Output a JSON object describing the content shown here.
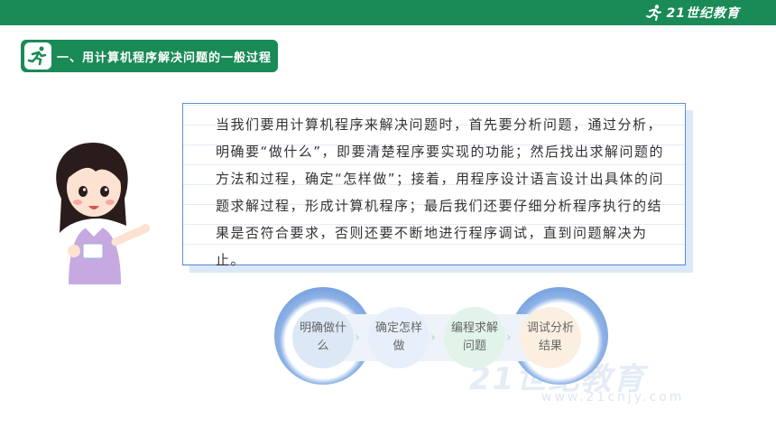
{
  "brand": {
    "name": "21世纪教育",
    "sub": "WWW.21CNJY.COM"
  },
  "section": {
    "title": "一、用计算机程序解决问题的一般过程",
    "icon": "runner-icon"
  },
  "card": {
    "text": "当我们要用计算机程序来解决问题时，首先要分析问题，通过分析，明确要“做什么”，即要清楚程序要实现的功能；然后找出求解问题的方法和过程，确定“怎样做”；接着，用程序设计语言设计出具体的问题求解过程，形成计算机程序；最后我们还要仔细分析程序执行的结果是否符合要求，否则还要不断地进行程序调试，直到问题解决为止。"
  },
  "flow": {
    "steps": [
      "明确做什么",
      "确定怎样做",
      "编程求解问题",
      "调试分析结果"
    ]
  },
  "watermark": {
    "main": "21世纪教育",
    "sub": "www.21cnjy.com"
  },
  "colors": {
    "accent": "#1a8a57",
    "card_border": "#5b8fd6",
    "circle": "#4c7fd3"
  }
}
